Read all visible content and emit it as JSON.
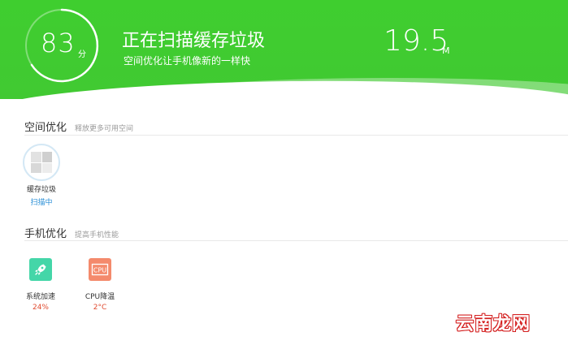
{
  "header": {
    "score": "83",
    "score_unit": "分",
    "title": "正在扫描缓存垃圾",
    "subtitle": "空间优化让手机像新的一样快",
    "size_value": "19.5",
    "size_unit": "M",
    "bg_color": "#41c932"
  },
  "space_section": {
    "title": "空间优化",
    "desc": "释放更多可用空间",
    "tiles": [
      {
        "label": "缓存垃圾",
        "status": "扫描中",
        "status_color": "#2a8fd6",
        "icon": "cache-icon"
      }
    ]
  },
  "phone_section": {
    "title": "手机优化",
    "desc": "提高手机性能",
    "tiles": [
      {
        "label": "系统加速",
        "status": "24%",
        "status_color": "#e04a2f",
        "icon": "rocket-icon"
      },
      {
        "label": "CPU降温",
        "status": "2°C",
        "status_color": "#e04a2f",
        "icon": "cpu-icon"
      }
    ]
  },
  "watermark": "云南龙网"
}
